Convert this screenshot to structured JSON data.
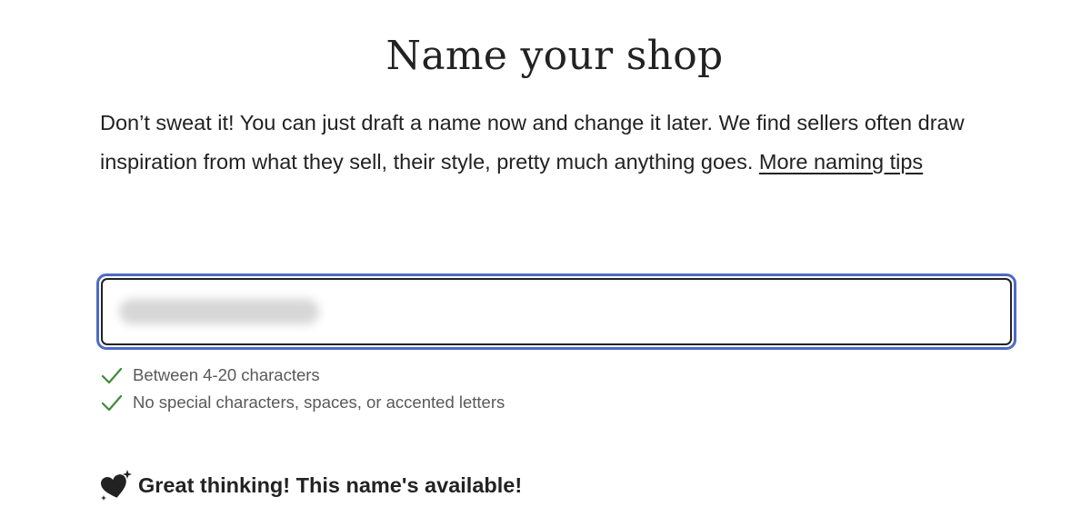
{
  "page": {
    "title": "Name your shop",
    "intro_text": "Don’t sweat it! You can just draft a name now and change it later. We find sellers often draw inspiration from what they sell, their style, pretty much anything goes. ",
    "tips_link": "More naming tips"
  },
  "shop_name_field": {
    "value": "",
    "focused": true,
    "accent_color": "#4d6bc6"
  },
  "rules": [
    {
      "label": "Between 4-20 characters",
      "met": true,
      "icon": "check-icon"
    },
    {
      "label": "No special characters, spaces, or accented letters",
      "met": true,
      "icon": "check-icon"
    }
  ],
  "status": {
    "icon": "sparkle-heart-icon",
    "text": "Great thinking! This name's available!"
  },
  "colors": {
    "check": "#3f8a3a",
    "text": "#222222",
    "muted": "#595959"
  }
}
